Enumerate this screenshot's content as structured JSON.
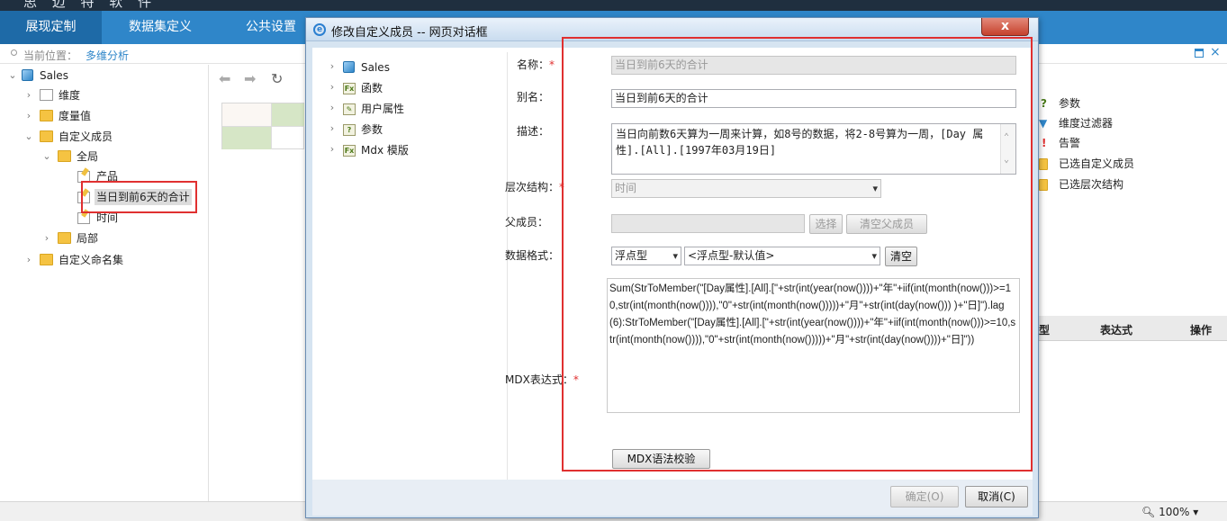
{
  "app": {
    "brand": "思 迈 特 软 件"
  },
  "nav": {
    "tabs": [
      "展现定制",
      "数据集定义",
      "公共设置"
    ]
  },
  "breadcrumb": {
    "label": "当前位置：",
    "current": "多维分析"
  },
  "tree": {
    "root": "Sales",
    "items": [
      "维度",
      "度量值",
      "自定义成员",
      "全局",
      "产品",
      "当日到前6天的合计",
      "时间",
      "局部",
      "自定义命名集"
    ]
  },
  "right_panel": {
    "items": [
      "参数",
      "维度过滤器",
      "告警",
      "已选自定义成员",
      "已选层次结构"
    ],
    "headers": [
      "型",
      "表达式",
      "操作"
    ]
  },
  "status": {
    "zoom": "100%"
  },
  "dialog": {
    "title": "修改自定义成员 -- 网页对话框",
    "close_symbol": "x",
    "left_tree": [
      "Sales",
      "函数",
      "用户属性",
      "参数",
      "Mdx 模版"
    ],
    "form": {
      "name_label": "名称：",
      "name_value": "当日到前6天的合计",
      "alias_label": "别名：",
      "alias_value": "当日到前6天的合计",
      "desc_label": "描述：",
      "desc_value": "当日向前数6天算为一周来计算，如8号的数据，将2-8号算为一周，[Day 属性].[All].[1997年03月19日]",
      "hier_label": "层次结构：",
      "hier_value": "时间",
      "parent_label": "父成员：",
      "parent_value": "",
      "select_btn": "选择",
      "clear_parent_btn": "清空父成员",
      "format_label": "数据格式：",
      "format_type": "浮点型",
      "format_value": "<浮点型-默认值>",
      "clear_btn": "清空",
      "mdx_label": "MDX表达式：",
      "mdx_value": "Sum(StrToMember(\"[Day属性].[All].[\"+str(int(year(now())))+\"年\"+iif(int(month(now()))>=10,str(int(month(now()))),\"0\"+str(int(month(now()))))+\"月\"+str(int(day(now())) )+\"日]\").lag(6):StrToMember(\"[Day属性].[All].[\"+str(int(year(now())))+\"年\"+iif(int(month(now()))>=10,str(int(month(now()))),\"0\"+str(int(month(now()))))+\"月\"+str(int(day(now())))+\"日]\"))",
      "check_btn": "MDX语法校验",
      "required_mark": "*"
    },
    "footer": {
      "ok": "确定(O)",
      "cancel": "取消(C)"
    }
  },
  "colors": {
    "nav": "#2f86c9",
    "nav_active": "#1e6aa7",
    "highlight": "#e03030"
  }
}
